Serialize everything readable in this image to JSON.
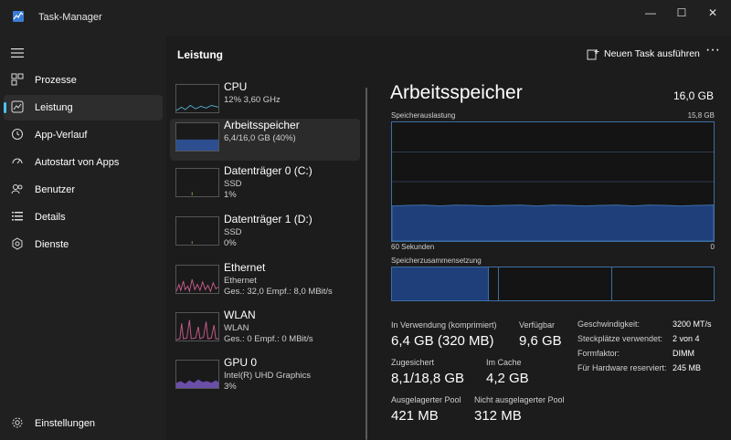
{
  "window": {
    "title": "Task-Manager",
    "controls": [
      "—",
      "☐",
      "✕"
    ]
  },
  "nav": {
    "items": [
      {
        "label": "Prozesse",
        "icon": "processes-icon",
        "active": false
      },
      {
        "label": "Leistung",
        "icon": "performance-icon",
        "active": true
      },
      {
        "label": "App-Verlauf",
        "icon": "history-icon",
        "active": false
      },
      {
        "label": "Autostart von Apps",
        "icon": "startup-icon",
        "active": false
      },
      {
        "label": "Benutzer",
        "icon": "users-icon",
        "active": false
      },
      {
        "label": "Details",
        "icon": "details-icon",
        "active": false
      },
      {
        "label": "Dienste",
        "icon": "services-icon",
        "active": false
      }
    ],
    "settings_label": "Einstellungen"
  },
  "header": {
    "page_title": "Leistung",
    "new_task_label": "Neuen Task ausführen",
    "more_label": "···"
  },
  "devices": [
    {
      "name": "CPU",
      "sub": "12%  3,60 GHz",
      "sub2": "",
      "color": "#4fa8c9"
    },
    {
      "name": "Arbeitsspeicher",
      "sub": "6,4/16,0 GB (40%)",
      "sub2": "",
      "color": "#2d4e8f"
    },
    {
      "name": "Datenträger 0 (C:)",
      "sub": "SSD",
      "sub2": "1%",
      "color": "#6aa84f"
    },
    {
      "name": "Datenträger 1 (D:)",
      "sub": "SSD",
      "sub2": "0%",
      "color": "#6aa84f"
    },
    {
      "name": "Ethernet",
      "sub": "Ethernet",
      "sub2": "Ges.: 32,0  Empf.: 8,0 MBit/s",
      "color": "#c45a8a"
    },
    {
      "name": "WLAN",
      "sub": "WLAN",
      "sub2": "Ges.: 0  Empf.: 0 MBit/s",
      "color": "#c45a8a"
    },
    {
      "name": "GPU 0",
      "sub": "Intel(R) UHD Graphics",
      "sub2": "3%",
      "color": "#8a6acb"
    }
  ],
  "memory": {
    "title": "Arbeitsspeicher",
    "total": "16,0 GB",
    "usage_label": "Speicherauslastung",
    "usage_max": "15,8 GB",
    "time_label": "60 Sekunden",
    "time_end": "0",
    "composition_label": "Speicherzusammensetzung",
    "usage_fraction": 0.4,
    "composition": {
      "in_use": 0.3,
      "modified": 0.03,
      "standby": 0.35,
      "free": 0.32
    },
    "stats": [
      {
        "label": "In Verwendung (komprimiert)",
        "value": "6,4 GB (320 MB)"
      },
      {
        "label": "Verfügbar",
        "value": "9,6 GB"
      },
      {
        "label": "Zugesichert",
        "value": "8,1/18,8 GB"
      },
      {
        "label": "Im Cache",
        "value": "4,2 GB"
      },
      {
        "label": "Ausgelagerter Pool",
        "value": "421 MB"
      },
      {
        "label": "Nicht ausgelagerter Pool",
        "value": "312 MB"
      }
    ],
    "properties": [
      {
        "label": "Geschwindigkeit:",
        "value": "3200 MT/s"
      },
      {
        "label": "Steckplätze verwendet:",
        "value": "2 von 4"
      },
      {
        "label": "Formfaktor:",
        "value": "DIMM"
      },
      {
        "label": "Für Hardware reserviert:",
        "value": "245 MB"
      }
    ]
  },
  "colors": {
    "accent": "#4cc2ff",
    "memory_fill": "#1f3f7a",
    "memory_line": "#3d6fa6"
  }
}
